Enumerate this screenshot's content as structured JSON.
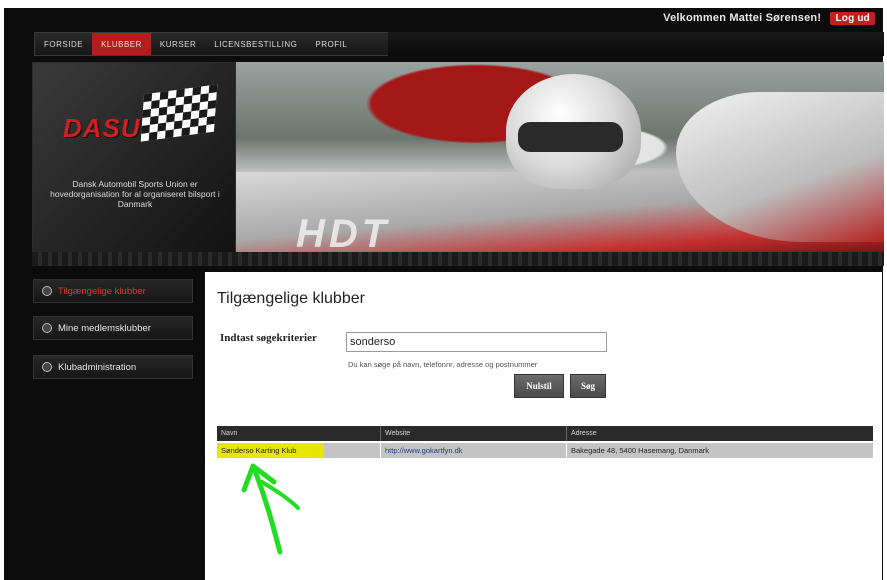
{
  "header": {
    "welcome_text": "Velkommen Mattei Sørensen!",
    "logout_label": "Log ud"
  },
  "nav": {
    "items": [
      {
        "label": "Forside",
        "active": false
      },
      {
        "label": "Klubber",
        "active": true
      },
      {
        "label": "Kurser",
        "active": false
      },
      {
        "label": "Licensbestilling",
        "active": false
      },
      {
        "label": "Profil",
        "active": false
      }
    ]
  },
  "banner": {
    "logo_text": "DASU",
    "description": "Dansk Automobil Sports Union er hovedorganisation for al organiseret bilsport i Danmark",
    "car_decal": "HDT"
  },
  "sidebar": {
    "items": [
      {
        "label": "Tilgængelige klubber",
        "active": true
      },
      {
        "label": "Mine medlemsklubber",
        "active": false
      },
      {
        "label": "Klubadministration",
        "active": false
      }
    ]
  },
  "main": {
    "title": "Tilgængelige klubber",
    "search": {
      "label": "Indtast søgekriterier",
      "value": "sonderso",
      "hint": "Du kan søge på navn, telefonnr, adresse og postnummer"
    },
    "buttons": {
      "reset_label": "Nulstil",
      "search_label": "Søg"
    },
    "table": {
      "headers": [
        "Navn",
        "Website",
        "Adresse"
      ],
      "rows": [
        {
          "name": "Sønderso Karting Klub",
          "website": "http://www.gokartfyn.dk",
          "address": "Bakegade 48, 5400 Hasemang, Danmark"
        }
      ]
    }
  },
  "colors": {
    "accent_red": "#b31d1d",
    "highlight_yellow": "#e6e600",
    "annotation_green": "#22dd22"
  }
}
